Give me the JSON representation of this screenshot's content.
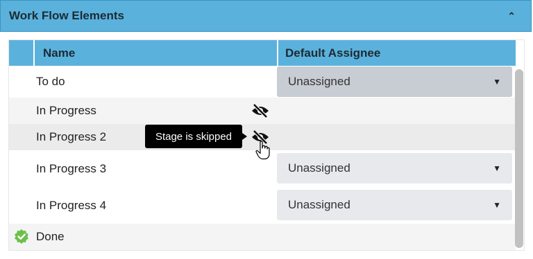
{
  "panel": {
    "title": "Work Flow Elements",
    "collapse_icon": "chevron-up-icon"
  },
  "table": {
    "columns": [
      "Name",
      "Default Assignee"
    ],
    "rows": [
      {
        "name": "To do",
        "assignee": "Unassigned",
        "skipped": false
      },
      {
        "name": "In Progress",
        "assignee": "",
        "skipped": true
      },
      {
        "name": "In Progress 2",
        "assignee": "",
        "skipped": true
      },
      {
        "name": "In Progress 3",
        "assignee": "Unassigned",
        "skipped": false
      },
      {
        "name": "In Progress 4",
        "assignee": "Unassigned",
        "skipped": false
      },
      {
        "name": "Done",
        "assignee": "",
        "skipped": false,
        "status_icon": "check-badge-icon"
      }
    ]
  },
  "tooltip": {
    "text": "Stage is skipped"
  },
  "colors": {
    "header": "#5ab2dc",
    "select_dark": "#c8cdd3",
    "select_light": "#e7e9ed",
    "done_green": "#6cc04a"
  }
}
